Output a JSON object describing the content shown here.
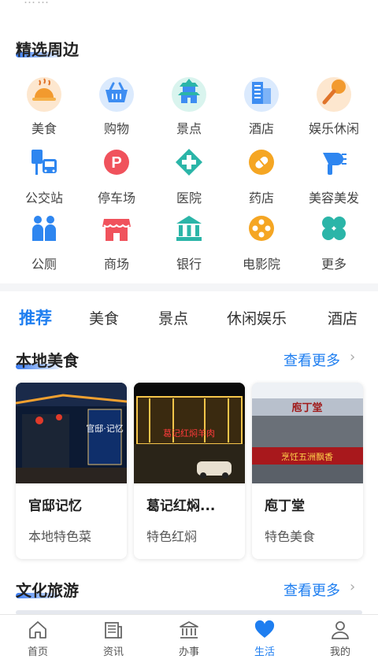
{
  "top_fragment": "……",
  "nearby": {
    "title": "精选周边",
    "items": [
      {
        "label": "美食",
        "icon": "food-icon"
      },
      {
        "label": "购物",
        "icon": "shopping-basket-icon"
      },
      {
        "label": "景点",
        "icon": "pagoda-icon"
      },
      {
        "label": "酒店",
        "icon": "hotel-icon"
      },
      {
        "label": "娱乐休闲",
        "icon": "microphone-icon"
      },
      {
        "label": "公交站",
        "icon": "bus-stop-icon"
      },
      {
        "label": "停车场",
        "icon": "parking-icon"
      },
      {
        "label": "医院",
        "icon": "hospital-cross-icon"
      },
      {
        "label": "药店",
        "icon": "pill-icon"
      },
      {
        "label": "美容美发",
        "icon": "hair-dryer-icon"
      },
      {
        "label": "公厕",
        "icon": "toilet-people-icon"
      },
      {
        "label": "商场",
        "icon": "store-icon"
      },
      {
        "label": "银行",
        "icon": "bank-icon"
      },
      {
        "label": "电影院",
        "icon": "film-reel-icon"
      },
      {
        "label": "更多",
        "icon": "more-clover-icon"
      }
    ]
  },
  "tabs": [
    {
      "label": "推荐",
      "active": true
    },
    {
      "label": "美食",
      "active": false
    },
    {
      "label": "景点",
      "active": false
    },
    {
      "label": "休闲娱乐",
      "active": false
    },
    {
      "label": "酒店",
      "active": false
    }
  ],
  "local_food": {
    "title": "本地美食",
    "more_label": "查看更多",
    "cards": [
      {
        "name": "官邸记忆",
        "sub": "本地特色菜",
        "sign": "官邸·记忆"
      },
      {
        "name": "葛记红焖...",
        "sub": "特色红焖",
        "sign": "葛记红焖羊肉"
      },
      {
        "name": "庖丁堂",
        "sub": "特色美食",
        "sign_top": "庖丁堂",
        "sign_bottom": "烹饪五洲飘香"
      }
    ]
  },
  "culture_travel": {
    "title": "文化旅游",
    "more_label": "查看更多"
  },
  "tabbar": [
    {
      "label": "首页",
      "icon": "home-icon",
      "active": false
    },
    {
      "label": "资讯",
      "icon": "news-icon",
      "active": false
    },
    {
      "label": "办事",
      "icon": "government-building-icon",
      "active": false
    },
    {
      "label": "生活",
      "icon": "heart-icon",
      "active": true
    },
    {
      "label": "我的",
      "icon": "user-icon",
      "active": false
    }
  ],
  "colors": {
    "accent": "#1e7ef0",
    "orange": "#f5a623",
    "red": "#f0525c",
    "teal": "#2bb5a8",
    "blue": "#2e86f0"
  }
}
